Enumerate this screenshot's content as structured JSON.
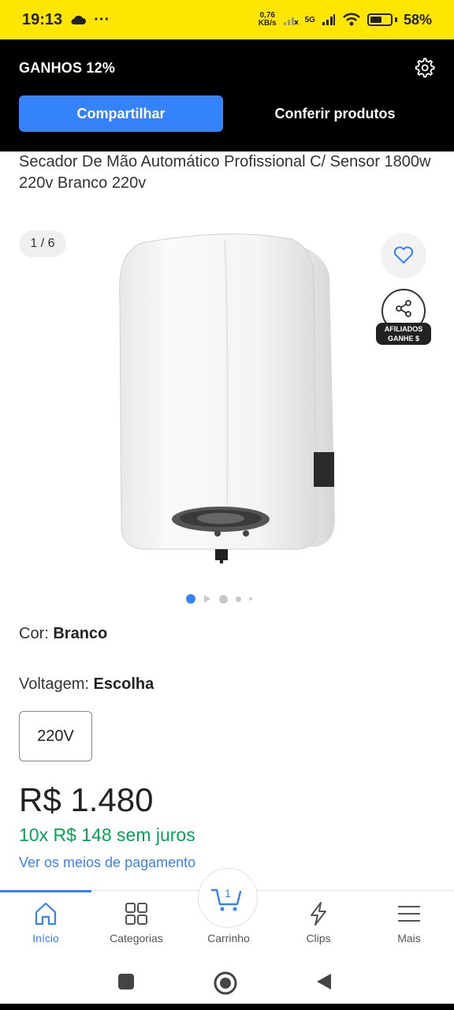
{
  "status_bar": {
    "time": "19:13",
    "dots": "···",
    "net_speed_value": "0,76",
    "net_speed_unit": "KB/s",
    "network": "5G",
    "battery": "58%",
    "battery_level": 0.58
  },
  "affiliate": {
    "earnings": "GANHOS 12%",
    "share_label": "Compartilhar",
    "products_label": "Conferir produtos"
  },
  "product": {
    "title": "Secador De Mão Automático Profissional C/ Sensor 1800w 220v Branco 220v",
    "image_counter": "1 / 6",
    "affiliate_badge_line1": "AFILIADOS",
    "affiliate_badge_line2": "GANHE $",
    "color_label": "Cor: ",
    "color_value": "Branco",
    "voltage_label": "Voltagem: ",
    "voltage_value": "Escolha",
    "voltage_option": "220V",
    "price": "R$ 1.480",
    "installments": "10x R$ 148 sem juros",
    "payment_link": "Ver os meios de pagamento"
  },
  "bottom_nav": {
    "items": [
      {
        "label": "Início",
        "icon": "home-icon"
      },
      {
        "label": "Categorias",
        "icon": "grid-icon"
      },
      {
        "label": "Carrinho",
        "icon": "cart-icon"
      },
      {
        "label": "Clips",
        "icon": "lightning-icon"
      },
      {
        "label": "Mais",
        "icon": "menu-icon"
      }
    ],
    "cart_count": "1"
  },
  "colors": {
    "accent": "#3483fa",
    "brand_yellow": "#ffe600",
    "green": "#00a650"
  }
}
